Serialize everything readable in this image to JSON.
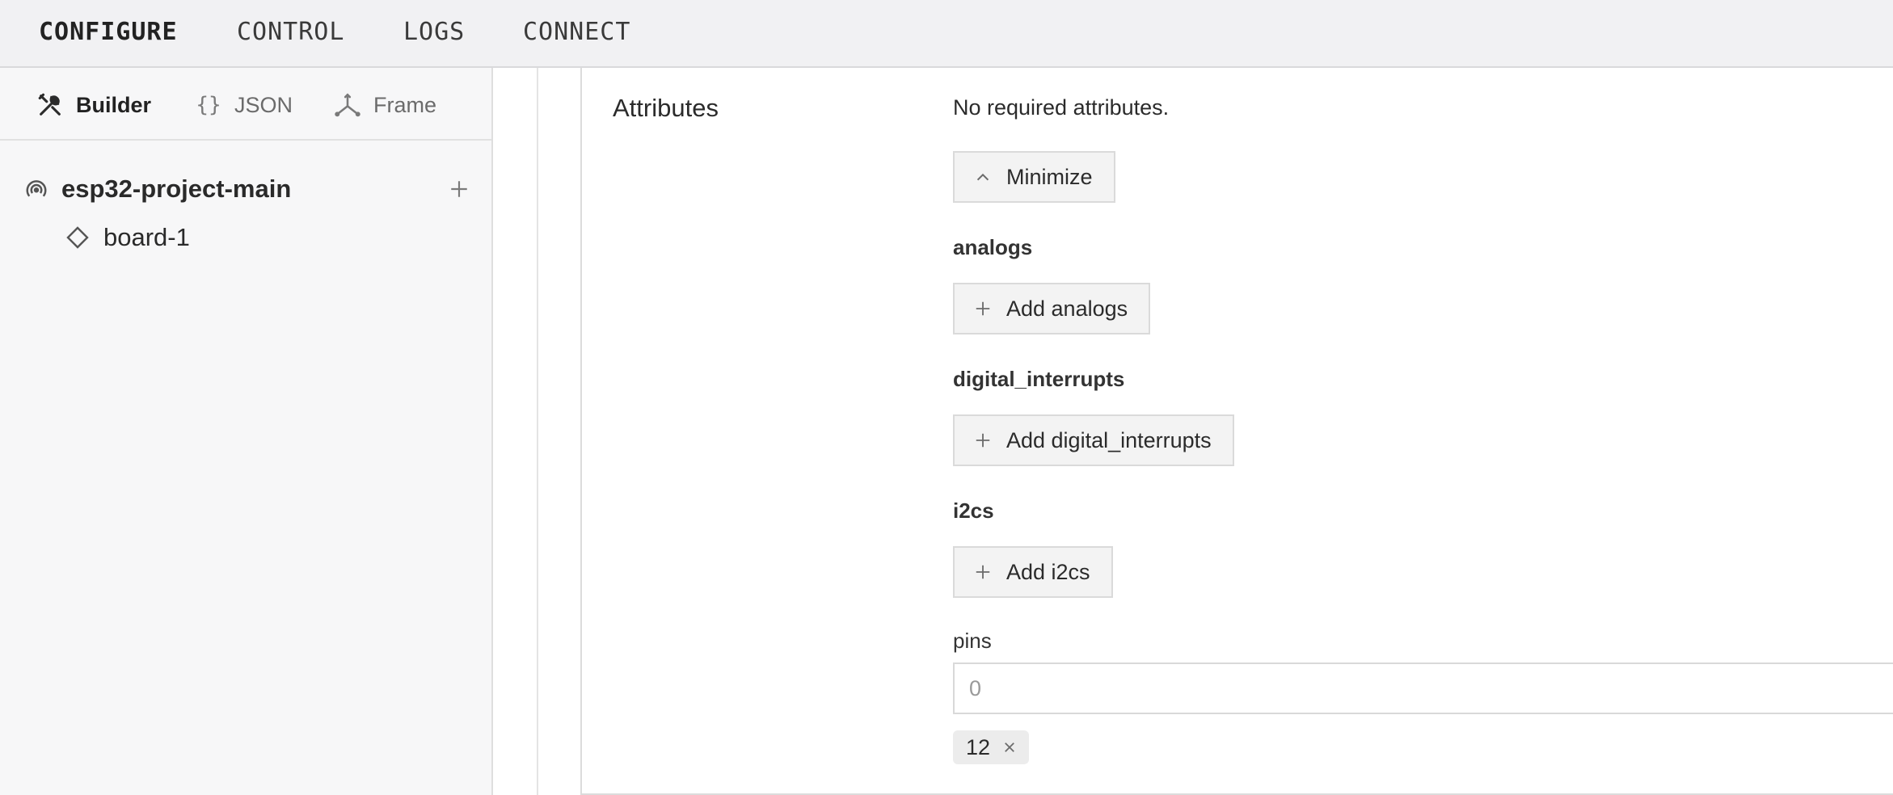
{
  "topnav": {
    "items": [
      {
        "label": "CONFIGURE",
        "active": true
      },
      {
        "label": "CONTROL",
        "active": false
      },
      {
        "label": "LOGS",
        "active": false
      },
      {
        "label": "CONNECT",
        "active": false
      }
    ]
  },
  "sidebar": {
    "tabs": [
      {
        "label": "Builder",
        "icon": "tools-icon",
        "active": true
      },
      {
        "label": "JSON",
        "icon": "braces-icon",
        "active": false
      },
      {
        "label": "Frame",
        "icon": "axes-icon",
        "active": false
      }
    ],
    "tree": {
      "root": {
        "label": "esp32-project-main",
        "icon": "machine-icon"
      },
      "children": [
        {
          "label": "board-1",
          "icon": "diamond-icon"
        }
      ]
    }
  },
  "attributes": {
    "title": "Attributes",
    "no_required": "No required attributes.",
    "minimize_label": "Minimize",
    "sections": [
      {
        "label": "analogs",
        "button": "Add analogs"
      },
      {
        "label": "digital_interrupts",
        "button": "Add digital_interrupts"
      },
      {
        "label": "i2cs",
        "button": "Add i2cs"
      }
    ],
    "pins": {
      "label": "pins",
      "placeholder": "0",
      "values": [
        "12"
      ]
    }
  },
  "colors": {
    "topbar_bg": "#f1f1f3",
    "sidebar_bg": "#f7f7f8",
    "button_bg": "#f3f3f3",
    "chip_bg": "#ececec"
  }
}
